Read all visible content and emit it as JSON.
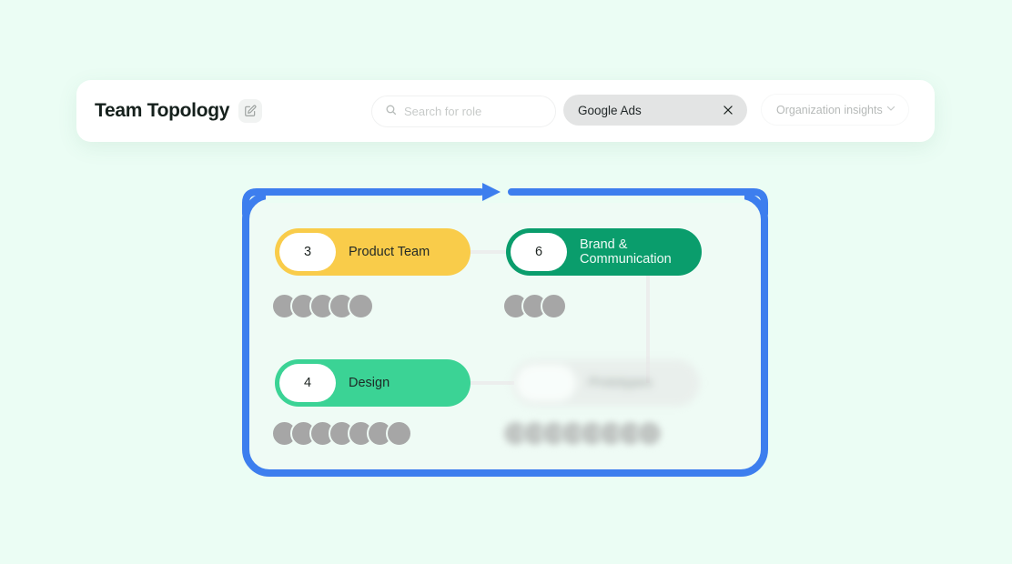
{
  "header": {
    "title": "Team Topology",
    "edit_icon": "pencil-edit-icon",
    "search": {
      "icon": "search-icon",
      "placeholder": "Search for role",
      "value": ""
    },
    "filter_chip": {
      "label": "Google Ads",
      "close_icon": "close-icon"
    },
    "dropdown": {
      "label": "Organization insights",
      "chevron_icon": "chevron-down-icon"
    }
  },
  "diagram": {
    "frame_color": "#3d7eee",
    "flow_arrow_icon": "arrow-right-icon",
    "nodes": [
      {
        "id": "product-team",
        "count": "3",
        "label": "Product Team",
        "color": "#f9cc4a",
        "avatars": 5
      },
      {
        "id": "brand-communication",
        "count": "6",
        "label": "Brand &\nCommunication",
        "color": "#0a9d6c",
        "avatars": 3
      },
      {
        "id": "design",
        "count": "4",
        "label": "Design",
        "color": "#3bd395",
        "avatars": 7
      },
      {
        "id": "prototypes",
        "count": "",
        "label": "Prototypes",
        "color": "#e6e8e7",
        "avatars": 8
      }
    ]
  },
  "colors": {
    "page_background": "#ebfdf4",
    "canvas_background": "#effbf5",
    "accent_blue": "#3d7eee",
    "yellow": "#f9cc4a",
    "green_dark": "#0a9d6c",
    "green_light": "#3bd395",
    "avatar_gray": "#a6a6a6"
  }
}
